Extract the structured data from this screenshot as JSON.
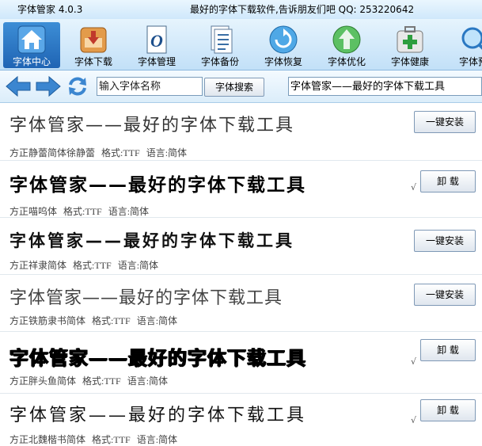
{
  "titlebar": {
    "app_name": "字体管家 4.0.3",
    "slogan": "最好的字体下载软件,告诉朋友们吧 QQ: 253220642"
  },
  "toolbar": {
    "items": [
      {
        "label": "字体中心",
        "icon": "home-icon"
      },
      {
        "label": "字体下载",
        "icon": "download-box-icon"
      },
      {
        "label": "字体管理",
        "icon": "font-manage-icon"
      },
      {
        "label": "字体备份",
        "icon": "document-icon"
      },
      {
        "label": "字体恢复",
        "icon": "restore-icon"
      },
      {
        "label": "字体优化",
        "icon": "optimize-icon"
      },
      {
        "label": "字体健康",
        "icon": "first-aid-icon"
      },
      {
        "label": "字体预",
        "icon": "magnifier-icon"
      }
    ]
  },
  "nav": {
    "search_placeholder": "输入字体名称",
    "search_button": "字体搜索",
    "preview_text": "字体管家——最好的字体下载工具"
  },
  "fonts": [
    {
      "preview": "字体管家——最好的字体下载工具",
      "name": "方正静蕾简体徐静蕾",
      "format": "格式:TTF",
      "language": "语言:简体",
      "action": "一键安装",
      "installed": false
    },
    {
      "preview": "字体管家——最好的字体下载工具",
      "name": "方正喵呜体",
      "format": "格式:TTF",
      "language": "语言:简体",
      "action": "卸 载",
      "installed": true
    },
    {
      "preview": "字体管家——最好的字体下载工具",
      "name": "方正祥隶简体",
      "format": "格式:TTF",
      "language": "语言:简体",
      "action": "一键安装",
      "installed": false
    },
    {
      "preview": "字体管家——最好的字体下载工具",
      "name": "方正铁筋隶书简体",
      "format": "格式:TTF",
      "language": "语言:简体",
      "action": "一键安装",
      "installed": false
    },
    {
      "preview": "字体管家——最好的字体下载工具",
      "name": "方正胖头鱼简体",
      "format": "格式:TTF",
      "language": "语言:简体",
      "action": "卸 载",
      "installed": true
    },
    {
      "preview": "字体管家——最好的字体下载工具",
      "name": "方正北魏楷书简体",
      "format": "格式:TTF",
      "language": "语言:简体",
      "action": "卸 载",
      "installed": true
    }
  ],
  "installed_mark": "√"
}
